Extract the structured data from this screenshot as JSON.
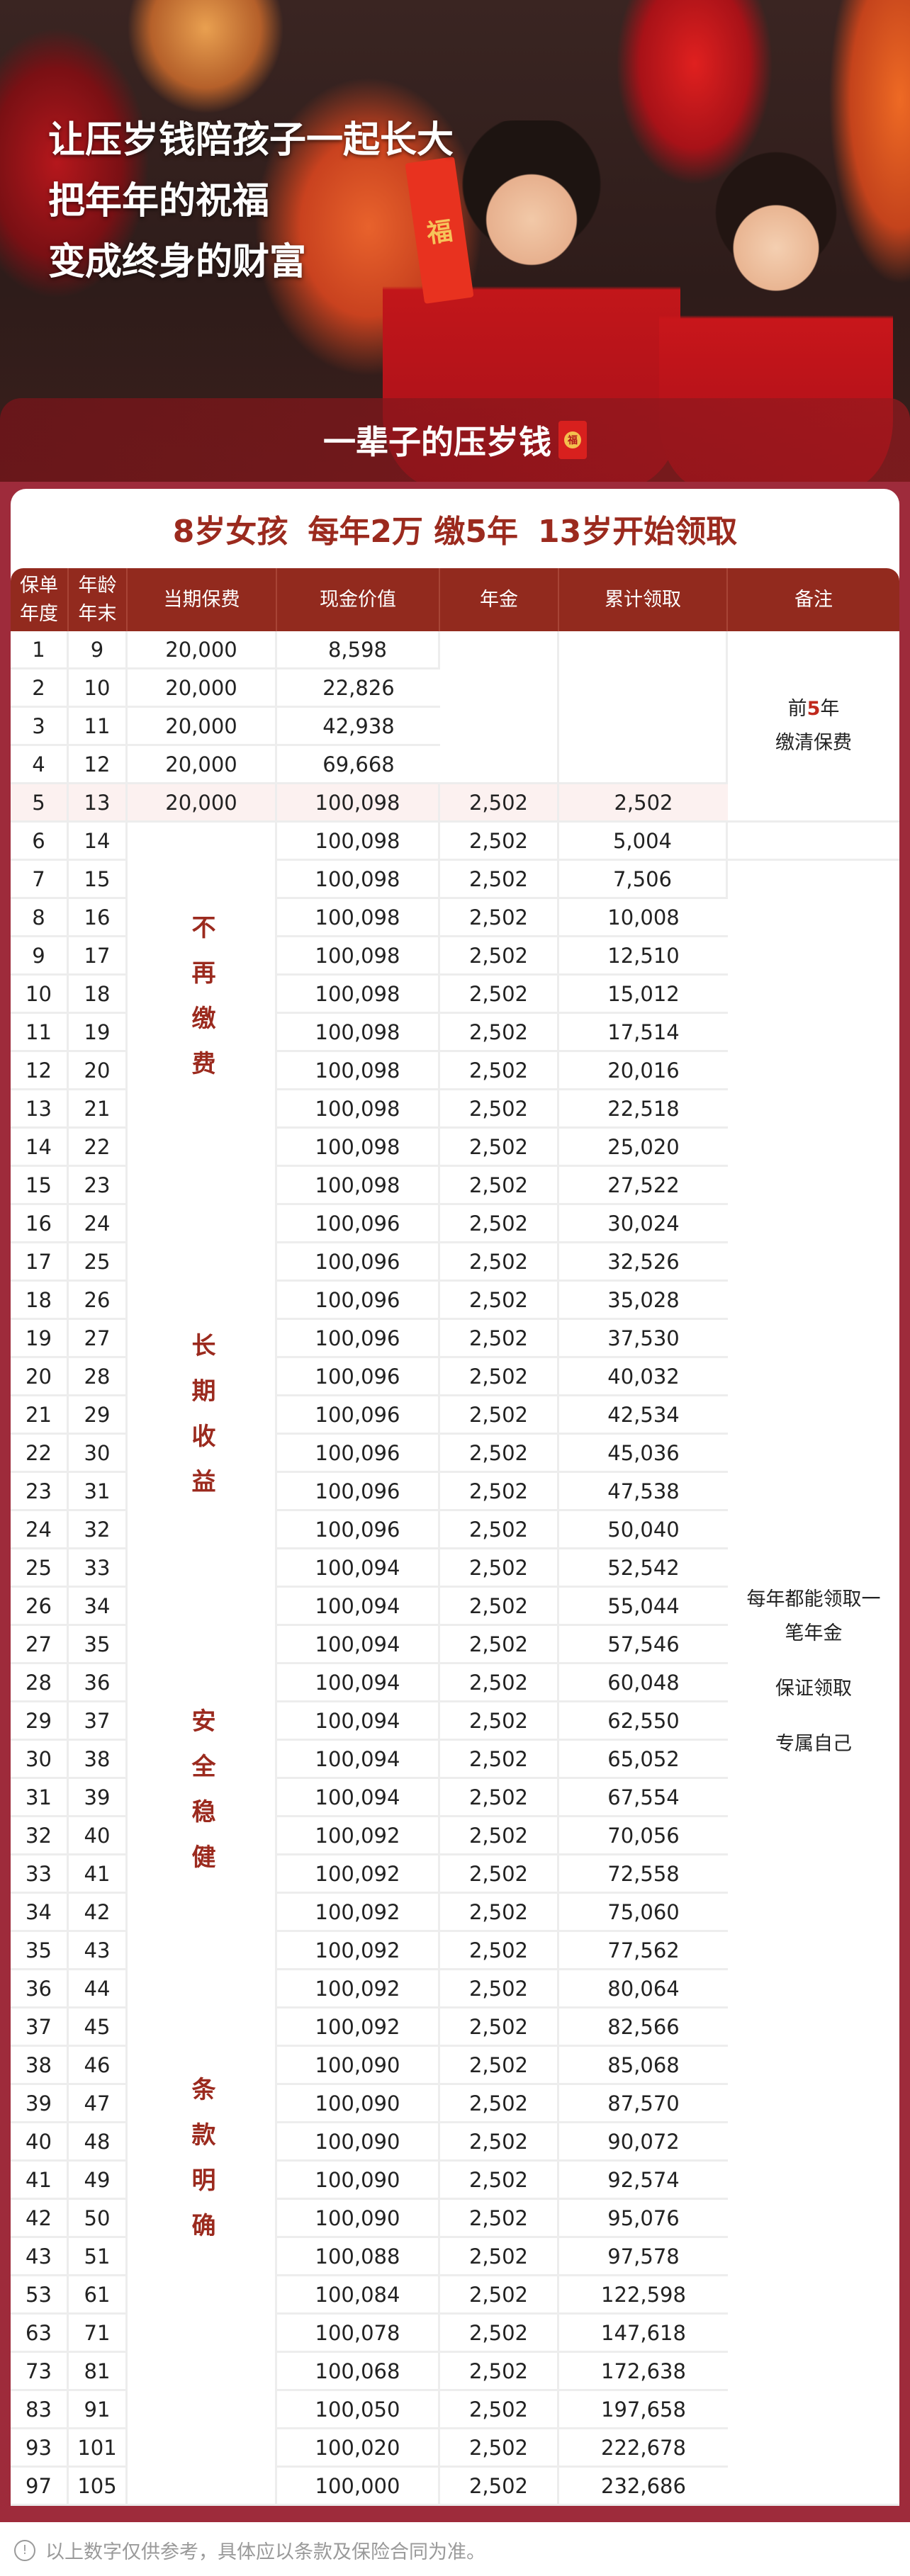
{
  "hero": {
    "lines": [
      "让压岁钱陪孩子一起长大",
      "把年年的祝福",
      "变成终身的财富"
    ],
    "envelope_char": "福",
    "band_title": "一辈子的压岁钱",
    "band_icon": "red-envelope-icon"
  },
  "summary": {
    "parts": [
      "8岁女孩",
      "每年2万 缴5年",
      "13岁开始领取"
    ]
  },
  "table": {
    "headers": [
      "保单\n年度",
      "年龄\n年末",
      "当期保费",
      "现金价值",
      "年金",
      "累计领取",
      "备注"
    ],
    "side_labels": [
      "不再缴费",
      "长期收益",
      "安全稳健",
      "条款明确"
    ],
    "remark_1": {
      "pre": "前",
      "num": "5",
      "post": "年",
      "line2": "缴清保费"
    },
    "remark_2": [
      "每年都能领取一笔年金",
      "保证领取",
      "专属自己"
    ],
    "rows": [
      [
        "1",
        "9",
        "20,000",
        "8,598",
        null,
        null
      ],
      [
        "2",
        "10",
        "20,000",
        "22,826",
        null,
        null
      ],
      [
        "3",
        "11",
        "20,000",
        "42,938",
        null,
        null
      ],
      [
        "4",
        "12",
        "20,000",
        "69,668",
        null,
        null
      ],
      [
        "5",
        "13",
        "20,000",
        "100,098",
        "2,502",
        "2,502"
      ],
      [
        "6",
        "14",
        null,
        "100,098",
        "2,502",
        "5,004"
      ],
      [
        "7",
        "15",
        null,
        "100,098",
        "2,502",
        "7,506"
      ],
      [
        "8",
        "16",
        null,
        "100,098",
        "2,502",
        "10,008"
      ],
      [
        "9",
        "17",
        null,
        "100,098",
        "2,502",
        "12,510"
      ],
      [
        "10",
        "18",
        null,
        "100,098",
        "2,502",
        "15,012"
      ],
      [
        "11",
        "19",
        null,
        "100,098",
        "2,502",
        "17,514"
      ],
      [
        "12",
        "20",
        null,
        "100,098",
        "2,502",
        "20,016"
      ],
      [
        "13",
        "21",
        null,
        "100,098",
        "2,502",
        "22,518"
      ],
      [
        "14",
        "22",
        null,
        "100,098",
        "2,502",
        "25,020"
      ],
      [
        "15",
        "23",
        null,
        "100,098",
        "2,502",
        "27,522"
      ],
      [
        "16",
        "24",
        null,
        "100,096",
        "2,502",
        "30,024"
      ],
      [
        "17",
        "25",
        null,
        "100,096",
        "2,502",
        "32,526"
      ],
      [
        "18",
        "26",
        null,
        "100,096",
        "2,502",
        "35,028"
      ],
      [
        "19",
        "27",
        null,
        "100,096",
        "2,502",
        "37,530"
      ],
      [
        "20",
        "28",
        null,
        "100,096",
        "2,502",
        "40,032"
      ],
      [
        "21",
        "29",
        null,
        "100,096",
        "2,502",
        "42,534"
      ],
      [
        "22",
        "30",
        null,
        "100,096",
        "2,502",
        "45,036"
      ],
      [
        "23",
        "31",
        null,
        "100,096",
        "2,502",
        "47,538"
      ],
      [
        "24",
        "32",
        null,
        "100,096",
        "2,502",
        "50,040"
      ],
      [
        "25",
        "33",
        null,
        "100,094",
        "2,502",
        "52,542"
      ],
      [
        "26",
        "34",
        null,
        "100,094",
        "2,502",
        "55,044"
      ],
      [
        "27",
        "35",
        null,
        "100,094",
        "2,502",
        "57,546"
      ],
      [
        "28",
        "36",
        null,
        "100,094",
        "2,502",
        "60,048"
      ],
      [
        "29",
        "37",
        null,
        "100,094",
        "2,502",
        "62,550"
      ],
      [
        "30",
        "38",
        null,
        "100,094",
        "2,502",
        "65,052"
      ],
      [
        "31",
        "39",
        null,
        "100,094",
        "2,502",
        "67,554"
      ],
      [
        "32",
        "40",
        null,
        "100,092",
        "2,502",
        "70,056"
      ],
      [
        "33",
        "41",
        null,
        "100,092",
        "2,502",
        "72,558"
      ],
      [
        "34",
        "42",
        null,
        "100,092",
        "2,502",
        "75,060"
      ],
      [
        "35",
        "43",
        null,
        "100,092",
        "2,502",
        "77,562"
      ],
      [
        "36",
        "44",
        null,
        "100,092",
        "2,502",
        "80,064"
      ],
      [
        "37",
        "45",
        null,
        "100,092",
        "2,502",
        "82,566"
      ],
      [
        "38",
        "46",
        null,
        "100,090",
        "2,502",
        "85,068"
      ],
      [
        "39",
        "47",
        null,
        "100,090",
        "2,502",
        "87,570"
      ],
      [
        "40",
        "48",
        null,
        "100,090",
        "2,502",
        "90,072"
      ],
      [
        "41",
        "49",
        null,
        "100,090",
        "2,502",
        "92,574"
      ],
      [
        "42",
        "50",
        null,
        "100,090",
        "2,502",
        "95,076"
      ],
      [
        "43",
        "51",
        null,
        "100,088",
        "2,502",
        "97,578"
      ],
      [
        "53",
        "61",
        null,
        "100,084",
        "2,502",
        "122,598"
      ],
      [
        "63",
        "71",
        null,
        "100,078",
        "2,502",
        "147,618"
      ],
      [
        "73",
        "81",
        null,
        "100,068",
        "2,502",
        "172,638"
      ],
      [
        "83",
        "91",
        null,
        "100,050",
        "2,502",
        "197,658"
      ],
      [
        "93",
        "101",
        null,
        "100,020",
        "2,502",
        "222,678"
      ],
      [
        "97",
        "105",
        null,
        "100,000",
        "2,502",
        "232,686"
      ]
    ]
  },
  "footer": {
    "icon": "info-icon",
    "note": "以上数字仅供参考，具体应以条款及保险合同为准。"
  },
  "colors": {
    "frame": "#9e2b3b",
    "header": "#922a1e",
    "accent_text": "#9b2a1e",
    "highlight_row": "#fcf1f0"
  }
}
